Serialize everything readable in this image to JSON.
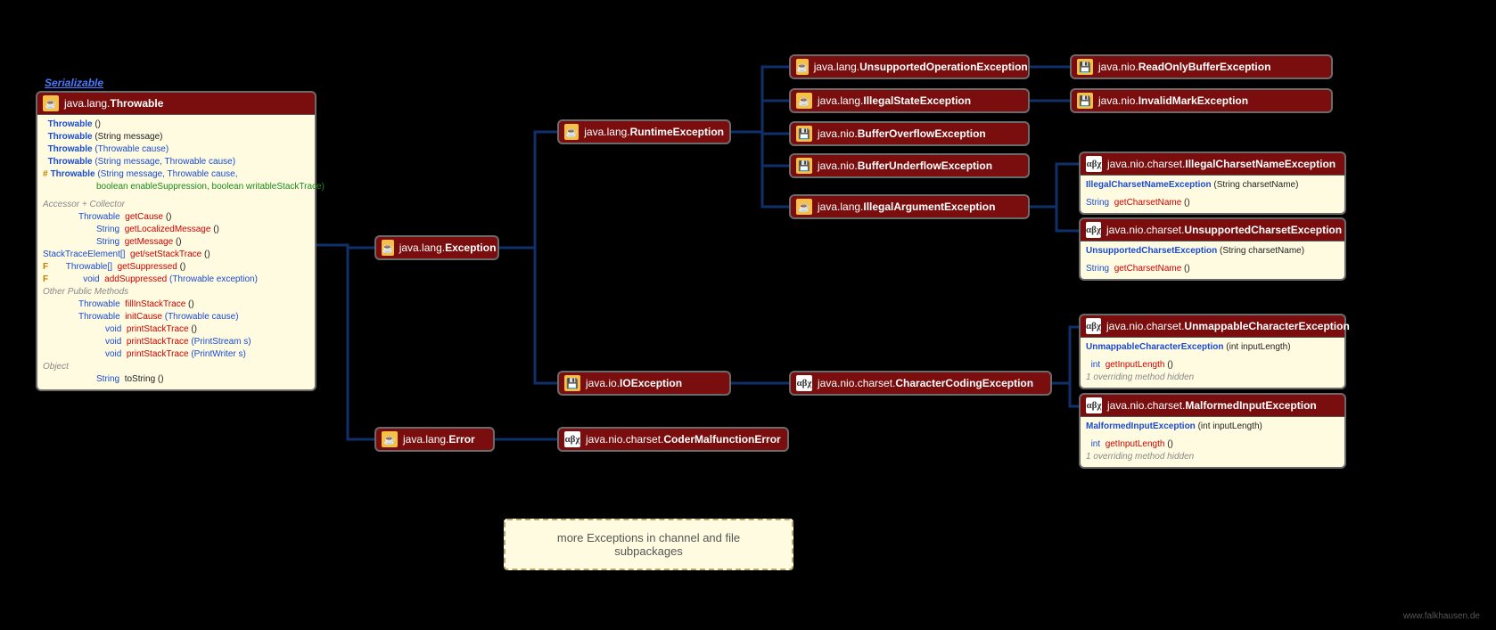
{
  "serializable": "Serializable",
  "watermark": "www.falkhausen.de",
  "note": "more Exceptions in channel and file subpackages",
  "nodes": {
    "throwable": {
      "pkg": "java.lang.",
      "cls": "Throwable"
    },
    "exception": {
      "pkg": "java.lang.",
      "cls": "Exception"
    },
    "error": {
      "pkg": "java.lang.",
      "cls": "Error"
    },
    "runtime": {
      "pkg": "java.lang.",
      "cls": "RuntimeException"
    },
    "ioexc": {
      "pkg": "java.io.",
      "cls": "IOException"
    },
    "codermal": {
      "pkg": "java.nio.charset.",
      "cls": "CoderMalfunctionError"
    },
    "unsup": {
      "pkg": "java.lang.",
      "cls": "UnsupportedOperationException"
    },
    "illstate": {
      "pkg": "java.lang.",
      "cls": "IllegalStateException"
    },
    "bufover": {
      "pkg": "java.nio.",
      "cls": "BufferOverflowException"
    },
    "bufunder": {
      "pkg": "java.nio.",
      "cls": "BufferUnderflowException"
    },
    "illarg": {
      "pkg": "java.lang.",
      "cls": "IllegalArgumentException"
    },
    "readonly": {
      "pkg": "java.nio.",
      "cls": "ReadOnlyBufferException"
    },
    "invmark": {
      "pkg": "java.nio.",
      "cls": "InvalidMarkException"
    },
    "charcoding": {
      "pkg": "java.nio.charset.",
      "cls": "CharacterCodingException"
    },
    "illcharset": {
      "pkg": "java.nio.charset.",
      "cls": "IllegalCharsetNameException"
    },
    "unsupcharset": {
      "pkg": "java.nio.charset.",
      "cls": "UnsupportedCharsetException"
    },
    "unmap": {
      "pkg": "java.nio.charset.",
      "cls": "UnmappableCharacterException"
    },
    "malformed": {
      "pkg": "java.nio.charset.",
      "cls": "MalformedInputException"
    }
  },
  "throwable_body": {
    "c1": "Throwable",
    "c1a": " ()",
    "c2": "Throwable",
    "c2a": " (String message)",
    "c3": "Throwable",
    "c3a": " (Throwable cause)",
    "c4": "Throwable",
    "c4a": " (String message, Throwable cause)",
    "c5p": "#",
    "c5": "Throwable",
    "c5a": " (String message, Throwable cause,",
    "c5b": "boolean enableSuppression, boolean writableStackTrace)",
    "sec1": "Accessor + Collector",
    "r1t": "Throwable",
    "r1m": "getCause",
    "r1a": " ()",
    "r2t": "String",
    "r2m": "getLocalizedMessage",
    "r2a": " ()",
    "r3t": "String",
    "r3m": "getMessage",
    "r3a": " ()",
    "r4t": "StackTraceElement[]",
    "r4m": "get/setStackTrace",
    "r4a": " ()",
    "r5f": "F",
    "r5t": "Throwable[]",
    "r5m": "getSuppressed",
    "r5a": " ()",
    "r6f": "F",
    "r6t": "void",
    "r6m": "addSuppressed",
    "r6a": " (Throwable exception)",
    "sec2": "Other Public Methods",
    "r7t": "Throwable",
    "r7m": "fillInStackTrace",
    "r7a": " ()",
    "r8t": "Throwable",
    "r8m": "initCause",
    "r8a": " (Throwable cause)",
    "r9t": "void",
    "r9m": "printStackTrace",
    "r9a": " ()",
    "r10t": "void",
    "r10m": "printStackTrace",
    "r10a": " (PrintStream s)",
    "r11t": "void",
    "r11m": "printStackTrace",
    "r11a": " (PrintWriter s)",
    "sec3": "Object",
    "r12t": "String",
    "r12m": "toString",
    "r12a": " ()"
  },
  "illcharset_body": {
    "c1": "IllegalCharsetNameException",
    "c1a": " (String charsetName)",
    "r1t": "String",
    "r1m": "getCharsetName",
    "r1a": " ()"
  },
  "unsupcharset_body": {
    "c1": "UnsupportedCharsetException",
    "c1a": " (String charsetName)",
    "r1t": "String",
    "r1m": "getCharsetName",
    "r1a": " ()"
  },
  "unmap_body": {
    "c1": "UnmappableCharacterException",
    "c1a": " (int inputLength)",
    "r1t": "int",
    "r1m": "getInputLength",
    "r1a": " ()",
    "ov": "1 overriding method hidden"
  },
  "malformed_body": {
    "c1": "MalformedInputException",
    "c1a": " (int inputLength)",
    "r1t": "int",
    "r1m": "getInputLength",
    "r1a": " ()",
    "ov": "1 overriding method hidden"
  }
}
